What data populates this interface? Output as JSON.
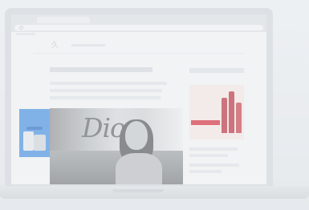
{
  "browser": {
    "icon": "reload-icon"
  },
  "site": {
    "logo_text": "久"
  },
  "left_ad": {
    "text": "",
    "accent_color": "#3f8de0"
  },
  "hero": {
    "script_text": "Dior",
    "description": "woman-portrait-over-city"
  },
  "right_ad": {
    "text": "",
    "accent_color": "#d4232f"
  }
}
